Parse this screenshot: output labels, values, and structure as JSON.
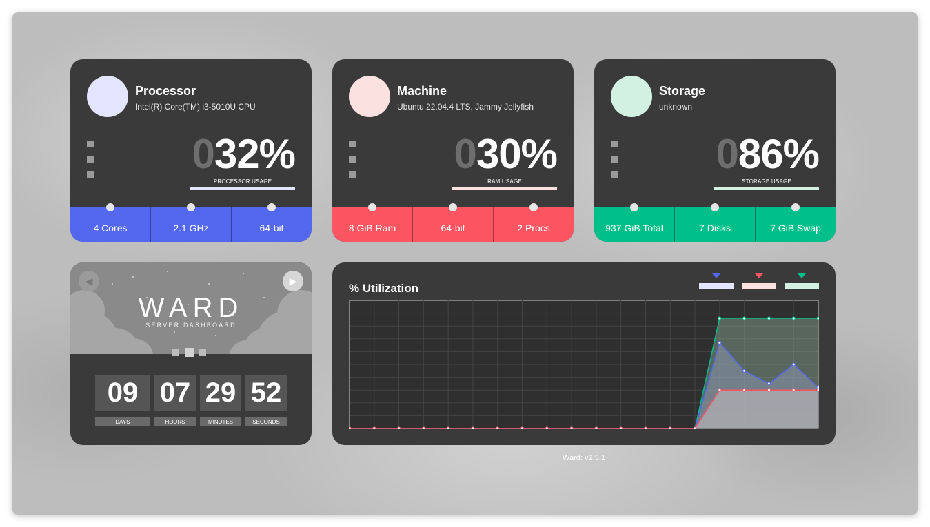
{
  "cards": [
    {
      "title": "Processor",
      "subtitle": "Intel(R) Core(TM) i3-5010U CPU",
      "usage_lead": "0",
      "usage_value": "32%",
      "usage_label": "PROCESSOR USAGE",
      "accent": "#5468ef",
      "avatar_color": "#e3e5fc",
      "stats": [
        "4 Cores",
        "2.1 GHz",
        "64-bit"
      ]
    },
    {
      "title": "Machine",
      "subtitle": "Ubuntu 22.04.4 LTS, Jammy Jellyfish",
      "usage_lead": "0",
      "usage_value": "30%",
      "usage_label": "RAM USAGE",
      "accent": "#fa5561",
      "avatar_color": "#fce1e1",
      "stats": [
        "8 GiB Ram",
        "64-bit",
        "2 Procs"
      ]
    },
    {
      "title": "Storage",
      "subtitle": "unknown",
      "usage_lead": "0",
      "usage_value": "86%",
      "usage_label": "STORAGE USAGE",
      "accent": "#00bf8a",
      "avatar_color": "#d2f1e2",
      "stats": [
        "937 GiB Total",
        "7 Disks",
        "7 GiB Swap"
      ]
    }
  ],
  "clock": {
    "logo": "WARD",
    "logo_sub": "SERVER DASHBOARD",
    "prev_icon": "◀",
    "next_icon": "▶",
    "units": [
      {
        "value": "09",
        "label": "DAYS"
      },
      {
        "value": "07",
        "label": "HOURS"
      },
      {
        "value": "29",
        "label": "MINUTES"
      },
      {
        "value": "52",
        "label": "SECONDS"
      }
    ]
  },
  "chart_title": "% Utilization",
  "chart_data": {
    "type": "area",
    "title": "% Utilization",
    "xlabel": "",
    "ylabel": "",
    "ylim": [
      0,
      100
    ],
    "x": [
      1,
      2,
      3,
      4,
      5,
      6,
      7,
      8,
      9,
      10,
      11,
      12,
      13,
      14,
      15,
      16,
      17,
      18,
      19,
      20
    ],
    "grid": true,
    "series": [
      {
        "color": "#00bf8a",
        "legend_color": "#d2f1e2",
        "values": [
          0,
          0,
          0,
          0,
          0,
          0,
          0,
          0,
          0,
          0,
          0,
          0,
          0,
          0,
          0,
          86,
          86,
          86,
          86,
          86
        ]
      },
      {
        "color": "#5468ef",
        "legend_color": "#e3e5fc",
        "values": [
          0,
          0,
          0,
          0,
          0,
          0,
          0,
          0,
          0,
          0,
          0,
          0,
          0,
          0,
          0,
          67,
          45,
          35,
          50,
          32
        ]
      },
      {
        "color": "#fa5561",
        "legend_color": "#fce1e1",
        "values": [
          0,
          0,
          0,
          0,
          0,
          0,
          0,
          0,
          0,
          0,
          0,
          0,
          0,
          0,
          0,
          30,
          30,
          30,
          30,
          30
        ]
      }
    ],
    "legend_order": [
      1,
      2,
      0
    ]
  },
  "footer": "Ward: v2.5.1"
}
